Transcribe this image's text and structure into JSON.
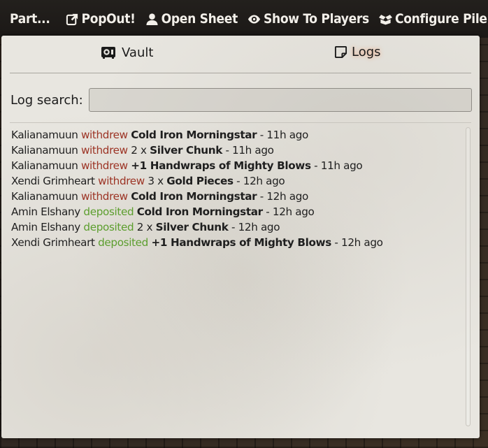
{
  "header": {
    "title": "Part...",
    "buttons": [
      {
        "label": "PopOut!",
        "icon": "external-link-icon"
      },
      {
        "label": "Open Sheet",
        "icon": "user-icon"
      },
      {
        "label": "Show To Players",
        "icon": "eye-icon"
      },
      {
        "label": "Configure Pile",
        "icon": "box-open-icon"
      }
    ]
  },
  "tabs": [
    {
      "label": "Vault",
      "icon": "vault-icon",
      "active": false
    },
    {
      "label": "Logs",
      "icon": "note-icon",
      "active": true
    }
  ],
  "search": {
    "label": "Log search:",
    "value": "",
    "placeholder": ""
  },
  "logs": [
    {
      "actor": "Kalianamuun",
      "action": "withdrew",
      "quantity": "",
      "item": "Cold Iron Morningstar",
      "time": "- 11h ago"
    },
    {
      "actor": "Kalianamuun",
      "action": "withdrew",
      "quantity": "2 x",
      "item": "Silver Chunk",
      "time": "- 11h ago"
    },
    {
      "actor": "Kalianamuun",
      "action": "withdrew",
      "quantity": "",
      "item": "+1 Handwraps of Mighty Blows",
      "time": "- 11h ago"
    },
    {
      "actor": "Xendi Grimheart",
      "action": "withdrew",
      "quantity": "3 x",
      "item": "Gold Pieces",
      "time": "- 12h ago"
    },
    {
      "actor": "Kalianamuun",
      "action": "withdrew",
      "quantity": "",
      "item": "Cold Iron Morningstar",
      "time": "- 12h ago"
    },
    {
      "actor": "Amin Elshany",
      "action": "deposited",
      "quantity": "",
      "item": "Cold Iron Morningstar",
      "time": "- 12h ago"
    },
    {
      "actor": "Amin Elshany",
      "action": "deposited",
      "quantity": "2 x",
      "item": "Silver Chunk",
      "time": "- 12h ago"
    },
    {
      "actor": "Xendi Grimheart",
      "action": "deposited",
      "quantity": "",
      "item": "+1 Handwraps of Mighty Blows",
      "time": "- 12h ago"
    }
  ],
  "colors": {
    "withdrew": "#9c3324",
    "deposited": "#5c9e2e",
    "active_tab_glow": "#ff6e28"
  }
}
